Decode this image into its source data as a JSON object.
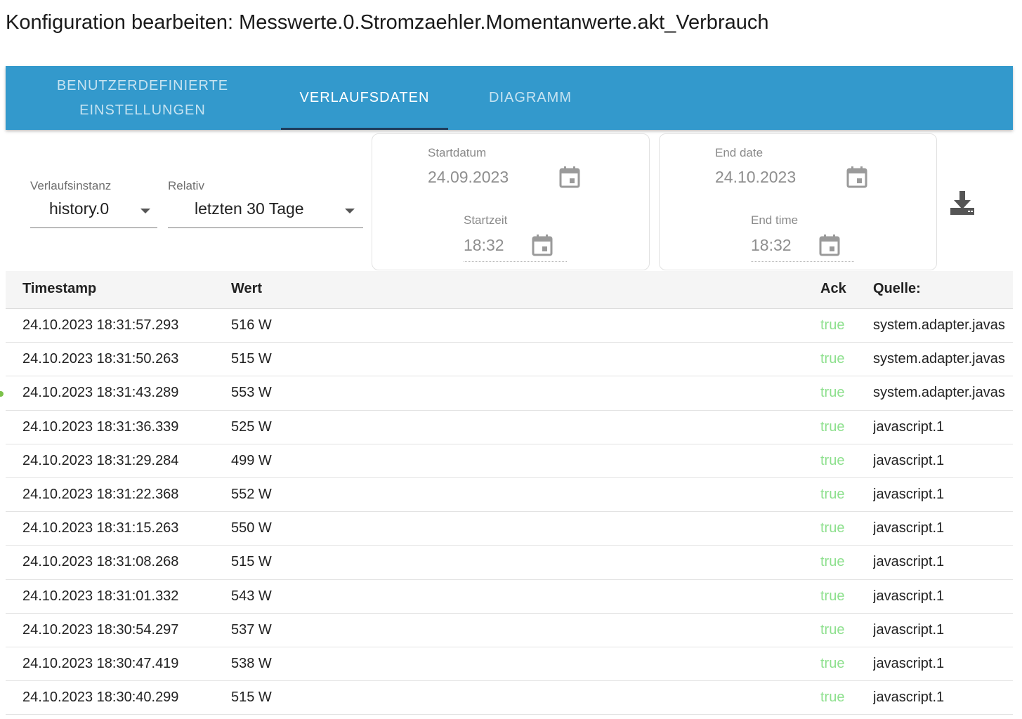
{
  "title": "Konfiguration bearbeiten: Messwerte.0.Stromzaehler.Momentanwerte.akt_Verbrauch",
  "tabs": [
    {
      "line1": "BENUTZERDEFINIERTE",
      "line2": "EINSTELLUNGEN"
    },
    {
      "label": "VERLAUFSDATEN"
    },
    {
      "label": "DIAGRAMM"
    }
  ],
  "controls": {
    "instance_label": "Verlaufsinstanz",
    "instance_value": "history.0",
    "relative_label": "Relativ",
    "relative_value": "letzten 30 Tage",
    "start_date_label": "Startdatum",
    "start_date_value": "24.09.2023",
    "start_time_label": "Startzeit",
    "start_time_value": "18:32",
    "end_date_label": "End date",
    "end_date_value": "24.10.2023",
    "end_time_label": "End time",
    "end_time_value": "18:32"
  },
  "table": {
    "headers": {
      "timestamp": "Timestamp",
      "value": "Wert",
      "ack": "Ack",
      "source": "Quelle:"
    },
    "rows": [
      {
        "ts": "24.10.2023 18:31:57.293",
        "val": "516 W",
        "ack": "true",
        "src": "system.adapter.javas"
      },
      {
        "ts": "24.10.2023 18:31:50.263",
        "val": "515 W",
        "ack": "true",
        "src": "system.adapter.javas"
      },
      {
        "ts": "24.10.2023 18:31:43.289",
        "val": "553 W",
        "ack": "true",
        "src": "system.adapter.javas"
      },
      {
        "ts": "24.10.2023 18:31:36.339",
        "val": "525 W",
        "ack": "true",
        "src": "javascript.1"
      },
      {
        "ts": "24.10.2023 18:31:29.284",
        "val": "499 W",
        "ack": "true",
        "src": "javascript.1"
      },
      {
        "ts": "24.10.2023 18:31:22.368",
        "val": "552 W",
        "ack": "true",
        "src": "javascript.1"
      },
      {
        "ts": "24.10.2023 18:31:15.263",
        "val": "550 W",
        "ack": "true",
        "src": "javascript.1"
      },
      {
        "ts": "24.10.2023 18:31:08.268",
        "val": "515 W",
        "ack": "true",
        "src": "javascript.1"
      },
      {
        "ts": "24.10.2023 18:31:01.332",
        "val": "543 W",
        "ack": "true",
        "src": "javascript.1"
      },
      {
        "ts": "24.10.2023 18:30:54.297",
        "val": "537 W",
        "ack": "true",
        "src": "javascript.1"
      },
      {
        "ts": "24.10.2023 18:30:47.419",
        "val": "538 W",
        "ack": "true",
        "src": "javascript.1"
      },
      {
        "ts": "24.10.2023 18:30:40.299",
        "val": "515 W",
        "ack": "true",
        "src": "javascript.1"
      }
    ]
  },
  "icons": {
    "calendar": "calendar-icon",
    "download": "download-icon",
    "dropdown": "chevron-down-icon"
  },
  "colors": {
    "tab_bar": "#3399cc",
    "tab_indicator": "#1f3d5c",
    "ack_true": "#8ee08e"
  }
}
